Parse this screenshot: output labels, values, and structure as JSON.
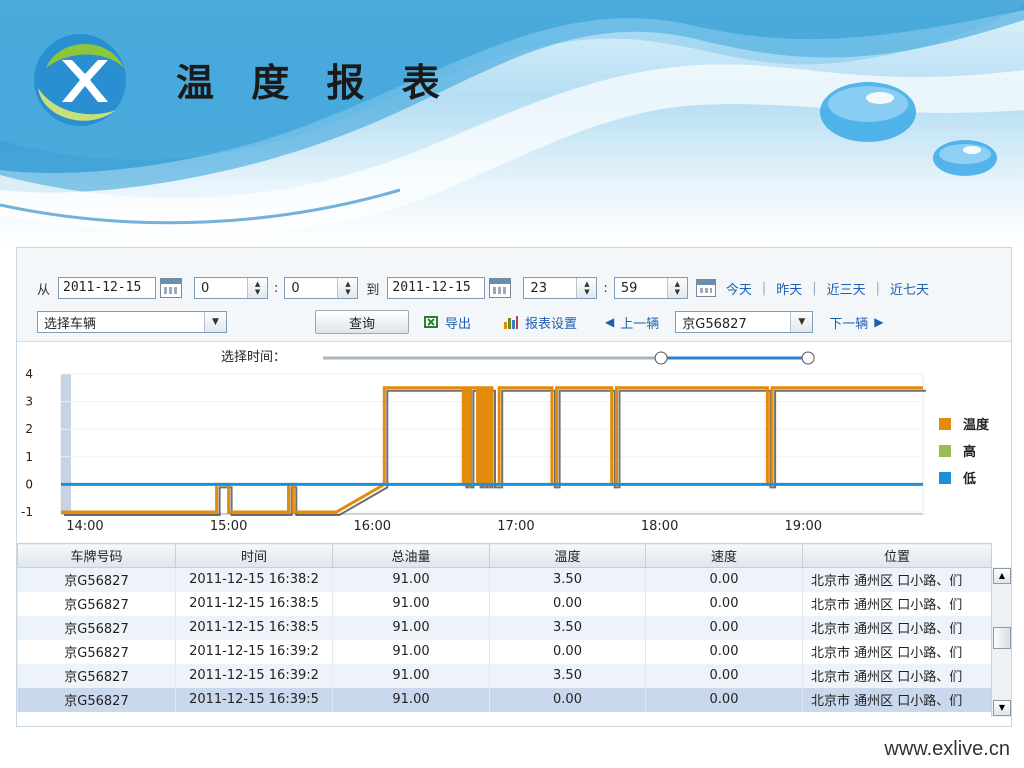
{
  "header": {
    "title": "温 度 报 表"
  },
  "toolbar": {
    "from_label": "从",
    "from_date": "2011-12-15",
    "from_hour": "0",
    "from_minute": "0",
    "colon": ":",
    "to_label": "到",
    "to_date": "2011-12-15",
    "to_hour": "23",
    "to_minute": "59",
    "quick_ranges": [
      "今天",
      "昨天",
      "近三天",
      "近七天"
    ],
    "separator": "|",
    "vehicle_select": "选择车辆",
    "query_button": "查询",
    "export_button": "导出",
    "report_settings_button": "报表设置",
    "prev_vehicle": "上一辆",
    "vehicle_plate": "京G56827",
    "next_vehicle": "下一辆"
  },
  "slider": {
    "label": "选择时间：",
    "start_fraction": 0.69,
    "end_fraction": 0.99
  },
  "chart_data": {
    "type": "line",
    "y_ticks": [
      "4",
      "3",
      "2",
      "1",
      "0",
      "-1"
    ],
    "ylim": [
      -1,
      4
    ],
    "x_ticks": [
      "14:00",
      "15:00",
      "16:00",
      "17:00",
      "18:00",
      "19:00"
    ],
    "xlim": [
      "13:50",
      "19:50"
    ],
    "legend_position": "right",
    "series": [
      {
        "name": "温度",
        "color": "#e38b0b",
        "points": [
          [
            "13:50",
            -1
          ],
          [
            "14:55",
            -1
          ],
          [
            "14:55",
            0
          ],
          [
            "15:00",
            0
          ],
          [
            "15:00",
            -1
          ],
          [
            "15:25",
            -1
          ],
          [
            "15:25",
            0
          ],
          [
            "15:27",
            0
          ],
          [
            "15:27",
            -1
          ],
          [
            "15:45",
            -1
          ],
          [
            "16:05",
            0
          ],
          [
            "16:05",
            3.5
          ],
          [
            "16:38",
            3.5
          ],
          [
            "16:38",
            0
          ],
          [
            "16:39",
            0
          ],
          [
            "16:39",
            3.5
          ],
          [
            "16:40",
            3.5
          ],
          [
            "16:40",
            0
          ],
          [
            "16:41",
            0
          ],
          [
            "16:41",
            3.5
          ],
          [
            "16:44",
            3.5
          ],
          [
            "16:44",
            0
          ],
          [
            "16:45",
            0
          ],
          [
            "16:45",
            3.5
          ],
          [
            "16:46",
            3.5
          ],
          [
            "16:46",
            0
          ],
          [
            "16:47",
            0
          ],
          [
            "16:47",
            3.5
          ],
          [
            "16:48",
            3.5
          ],
          [
            "16:48",
            0
          ],
          [
            "16:49",
            0
          ],
          [
            "16:49",
            3.5
          ],
          [
            "16:50",
            3.5
          ],
          [
            "16:50",
            0
          ],
          [
            "16:53",
            0
          ],
          [
            "16:53",
            3.5
          ],
          [
            "17:15",
            3.5
          ],
          [
            "17:15",
            0
          ],
          [
            "17:17",
            0
          ],
          [
            "17:17",
            3.5
          ],
          [
            "17:40",
            3.5
          ],
          [
            "17:40",
            0
          ],
          [
            "17:42",
            0
          ],
          [
            "17:42",
            3.5
          ],
          [
            "18:45",
            3.5
          ],
          [
            "18:45",
            0
          ],
          [
            "18:47",
            0
          ],
          [
            "18:47",
            3.5
          ],
          [
            "19:50",
            3.5
          ]
        ]
      },
      {
        "name": "高",
        "color": "#9bbb59",
        "points": []
      },
      {
        "name": "低",
        "color": "#1f8fd6",
        "points": [
          [
            "13:50",
            0
          ],
          [
            "19:50",
            0
          ]
        ]
      }
    ]
  },
  "table": {
    "columns": [
      "车牌号码",
      "时间",
      "总油量",
      "温度",
      "速度",
      "位置"
    ],
    "rows": [
      [
        "京G56827",
        "2011-12-15 16:38:2",
        "91.00",
        "3.50",
        "0.00",
        "北京市 通州区 口小路、们"
      ],
      [
        "京G56827",
        "2011-12-15 16:38:5",
        "91.00",
        "0.00",
        "0.00",
        "北京市 通州区 口小路、们"
      ],
      [
        "京G56827",
        "2011-12-15 16:38:5",
        "91.00",
        "3.50",
        "0.00",
        "北京市 通州区 口小路、们"
      ],
      [
        "京G56827",
        "2011-12-15 16:39:2",
        "91.00",
        "0.00",
        "0.00",
        "北京市 通州区 口小路、们"
      ],
      [
        "京G56827",
        "2011-12-15 16:39:2",
        "91.00",
        "3.50",
        "0.00",
        "北京市 通州区 口小路、们"
      ],
      [
        "京G56827",
        "2011-12-15 16:39:5",
        "91.00",
        "0.00",
        "0.00",
        "北京市 通州区 口小路、们"
      ]
    ]
  },
  "footer": {
    "url": "www.exlive.cn"
  },
  "colors": {
    "accent": "#1f5fb0",
    "temperature": "#e38b0b",
    "high": "#9bbb59",
    "low": "#1f8fd6"
  }
}
